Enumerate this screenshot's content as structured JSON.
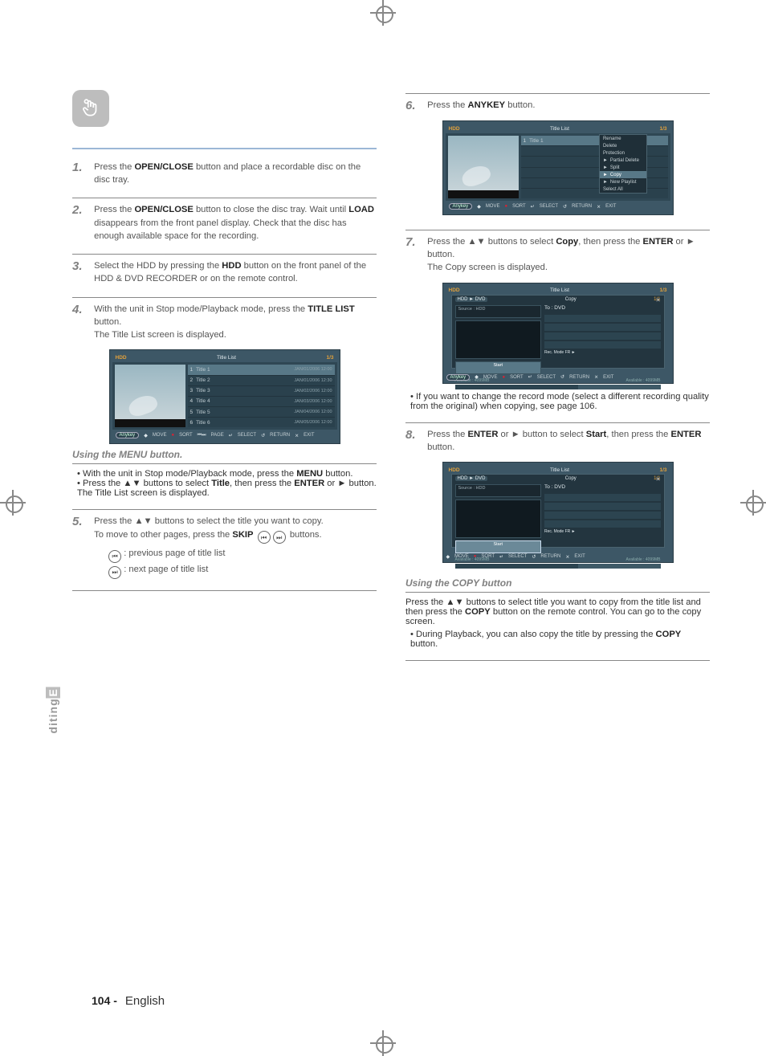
{
  "side_tab": {
    "prefix": "E",
    "rest": "diting"
  },
  "footer": {
    "page_number": "104 -",
    "language": "English"
  },
  "left": {
    "step1": {
      "num": "1.",
      "t1": "Press the ",
      "b1": "OPEN/CLOSE",
      "t2": " button and place a recordable disc on the disc tray."
    },
    "step2": {
      "num": "2.",
      "t1": " Press the ",
      "b1": "OPEN/CLOSE",
      "t2": " button to close the disc tray. Wait until ",
      "b2": "LOAD",
      "t3": " disappears from the front panel display. Check that the disc has enough available space for the recording."
    },
    "step3": {
      "num": "3.",
      "t1": "Select the HDD by pressing the ",
      "b1": "HDD",
      "t2": " button on the front panel of the HDD & DVD RECORDER or on the remote control."
    },
    "step4": {
      "num": "4.",
      "t1": "With the unit in Stop mode/Playback mode, press the ",
      "b1": "TITLE LIST",
      "t2": " button.",
      "t3": "The Title List screen is displayed."
    },
    "using": {
      "title": "Using the MENU button.",
      "l1a": "• With the unit in Stop mode/Playback mode, press the ",
      "l1b": "MENU",
      "l1c": " button.",
      "l2a": "• Press the ▲▼ buttons to select ",
      "l2b": "Title",
      "l2c": ", then press the ",
      "l2d": "ENTER",
      "l2e": " or ► button. The Title List screen is displayed."
    },
    "step5": {
      "num": "5.",
      "t1": "Press the ▲▼ buttons to select the title you want to copy.",
      "t2a": "To move to other pages, press the ",
      "t2b": "SKIP",
      "t2c": " buttons.",
      "prev": " : previous page of title list",
      "next": " : next page of title list"
    }
  },
  "right": {
    "step6": {
      "num": "6.",
      "t1": "Press the ",
      "b1": "ANYKEY",
      "t2": " button."
    },
    "step7": {
      "num": "7.",
      "t1": "Press the ▲▼ buttons to select ",
      "b1": "Copy",
      "t2": ", then press the ",
      "b2": "ENTER",
      "t3": " or ► button.",
      "t4": "The Copy screen is displayed.",
      "note": "• If you want to change the record mode (select a different recording quality from the original) when copying, see page 106."
    },
    "step8": {
      "num": "8.",
      "t1": "Press the ",
      "b1": "ENTER",
      "t2": " or ► button to select ",
      "b2": "Start",
      "t3": ", then press the ",
      "b3": "ENTER",
      "t4": " button."
    },
    "using2": {
      "title": "Using the COPY button",
      "p1a": "Press the ▲▼ buttons to select title you want to copy from the title list and then press the ",
      "p1b": "COPY",
      "p1c": " button on the remote control. You can go to the copy screen.",
      "p2a": "• During Playback, you can also copy the title by pressing the ",
      "p2b": "COPY",
      "p2c": " button."
    }
  },
  "screens": {
    "titleList": {
      "header_left": "HDD",
      "header_title": "Title List",
      "header_page": "1/3",
      "rows": [
        {
          "n": "1",
          "t": "Title 1",
          "d": "JAN/01/2006 12:00"
        },
        {
          "n": "2",
          "t": "Title 2",
          "d": "JAN/01/2006 12:30"
        },
        {
          "n": "3",
          "t": "Title 3",
          "d": "JAN/02/2006 12:00"
        },
        {
          "n": "4",
          "t": "Title 4",
          "d": "JAN/03/2006 12:00"
        },
        {
          "n": "5",
          "t": "Title 5",
          "d": "JAN/04/2006 12:00"
        },
        {
          "n": "6",
          "t": "Title 6",
          "d": "JAN/05/2006 12:00"
        }
      ],
      "footer": {
        "anykey": "Anykey",
        "move": "MOVE",
        "sort": "SORT",
        "page": "PAGE",
        "select": "SELECT",
        "return": "RETURN",
        "exit": "EXIT"
      }
    },
    "popup": {
      "items": [
        "Rename",
        "Delete",
        "Protection",
        "Partial Delete",
        "Split",
        "Copy",
        "New Playlist",
        "Select All"
      ],
      "selected": "Copy"
    },
    "copy": {
      "header_title": "Copy",
      "header_page": "1/1",
      "src_label": "Source : HDD",
      "dst_label": "To : DVD",
      "rec_mode": "Rec. Mode   FR  ►",
      "start": "Start",
      "avail_a": "Available : 4099MB",
      "avail_b": "Available : 4099MB"
    }
  }
}
